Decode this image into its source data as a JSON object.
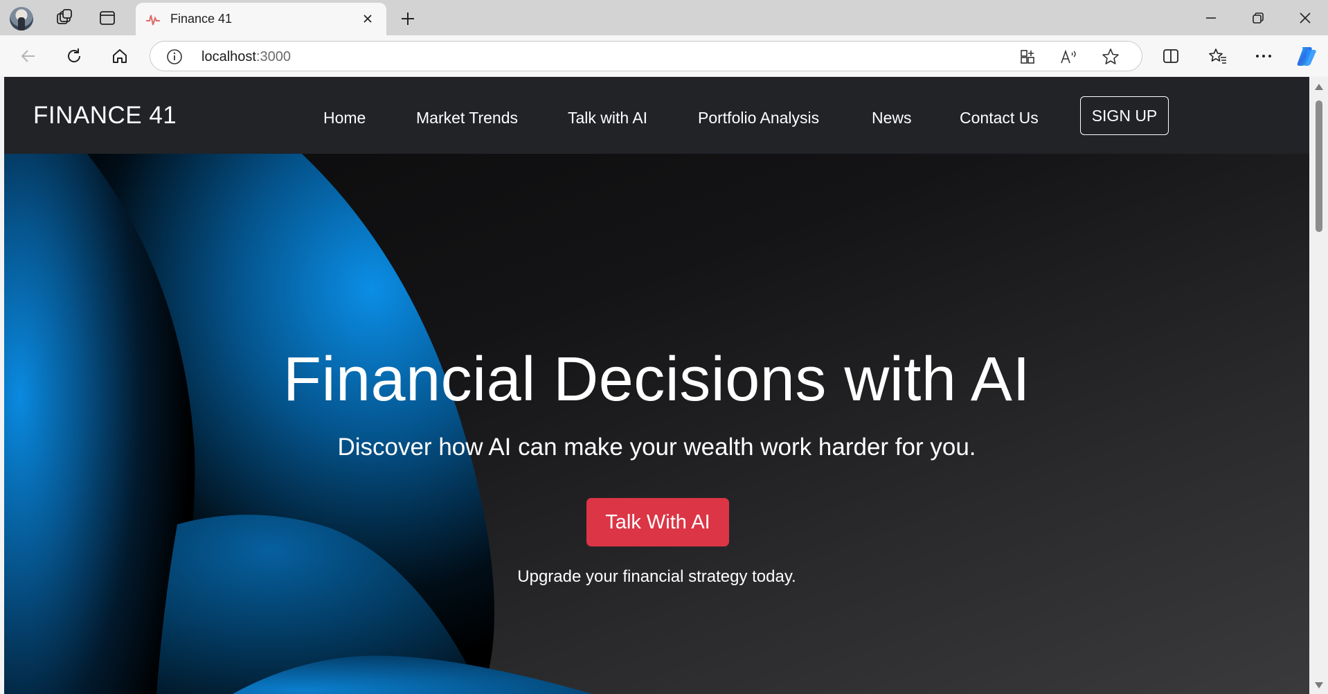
{
  "browser": {
    "tab_title": "Finance 41",
    "url_host": "localhost",
    "url_port": ":3000"
  },
  "site": {
    "brand": "FINANCE 41",
    "nav": [
      "Home",
      "Market Trends",
      "Talk with AI",
      "Portfolio Analysis",
      "News",
      "Contact Us"
    ],
    "signup": "SIGN UP"
  },
  "hero": {
    "title": "Financial Decisions with AI",
    "subtitle": "Discover how AI can make your wealth work harder for you.",
    "cta": "Talk With AI",
    "note": "Upgrade your financial strategy today."
  },
  "colors": {
    "navbar": "#212327",
    "cta": "#dc3545",
    "accent_blue": "#0a84d6"
  }
}
